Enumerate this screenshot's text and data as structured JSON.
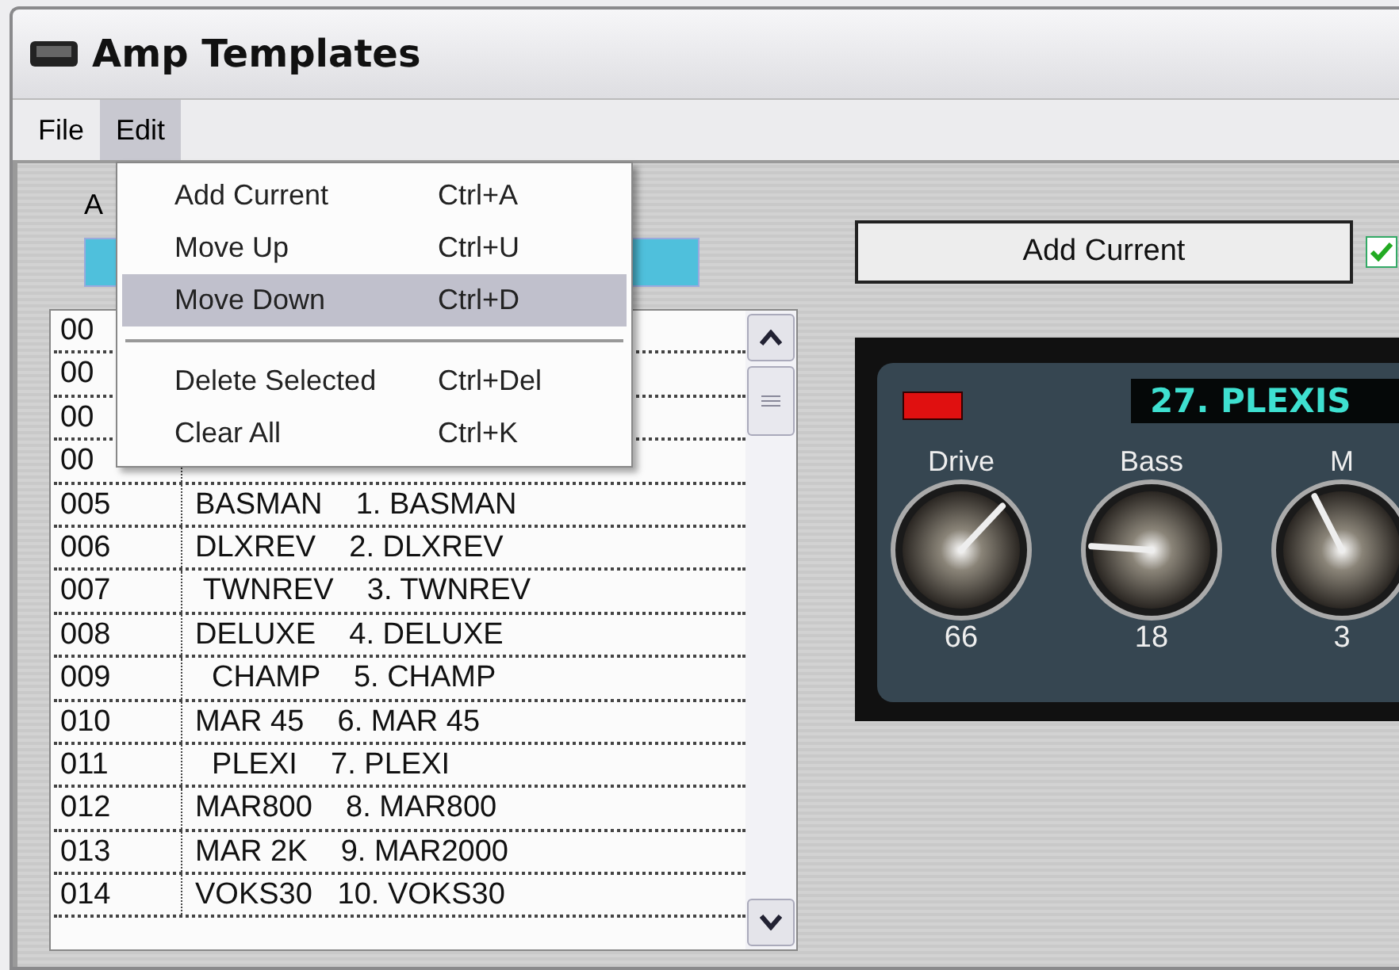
{
  "window": {
    "title": "Amp Templates"
  },
  "menu_bar": [
    {
      "label": "File",
      "selected": false
    },
    {
      "label": "Edit",
      "selected": true
    }
  ],
  "edit_menu": [
    {
      "label": "Add Current",
      "shortcut": "Ctrl+A",
      "selected": false,
      "separator_before": false
    },
    {
      "label": "Move Up",
      "shortcut": "Ctrl+U",
      "selected": false,
      "separator_before": false
    },
    {
      "label": "Move Down",
      "shortcut": "Ctrl+D",
      "selected": true,
      "separator_before": false
    },
    {
      "label": "Delete Selected",
      "shortcut": "Ctrl+Del",
      "selected": false,
      "separator_before": true
    },
    {
      "label": "Clear All",
      "shortcut": "Ctrl+K",
      "selected": false,
      "separator_before": false
    }
  ],
  "left_label": "A",
  "templates": [
    {
      "number": "00"
    },
    {
      "number": "00"
    },
    {
      "number": "00"
    },
    {
      "number": "00"
    },
    {
      "number": "005",
      "name": "BASMAN    1. BASMAN"
    },
    {
      "number": "006",
      "name": "DLXREV    2. DLXREV"
    },
    {
      "number": "007",
      "name": " TWNREV    3. TWNREV"
    },
    {
      "number": "008",
      "name": "DELUXE    4. DELUXE"
    },
    {
      "number": "009",
      "name": "  CHAMP    5. CHAMP"
    },
    {
      "number": "010",
      "name": "MAR 45    6. MAR 45"
    },
    {
      "number": "011",
      "name": "  PLEXI    7. PLEXI"
    },
    {
      "number": "012",
      "name": "MAR800    8. MAR800"
    },
    {
      "number": "013",
      "name": "MAR 2K    9. MAR2000"
    },
    {
      "number": "014",
      "name": "VOKS30   10. VOKS30"
    }
  ],
  "add_button": "Add Current",
  "option_checkbox": {
    "checked": true
  },
  "amp": {
    "led_on": true,
    "display": "27. PLEXIS",
    "knobs": [
      {
        "label": "Drive",
        "value": "66",
        "level": 0.66
      },
      {
        "label": "Bass",
        "value": "18",
        "level": 0.18
      },
      {
        "label": "M",
        "value": "3",
        "level": 0.4
      }
    ]
  }
}
